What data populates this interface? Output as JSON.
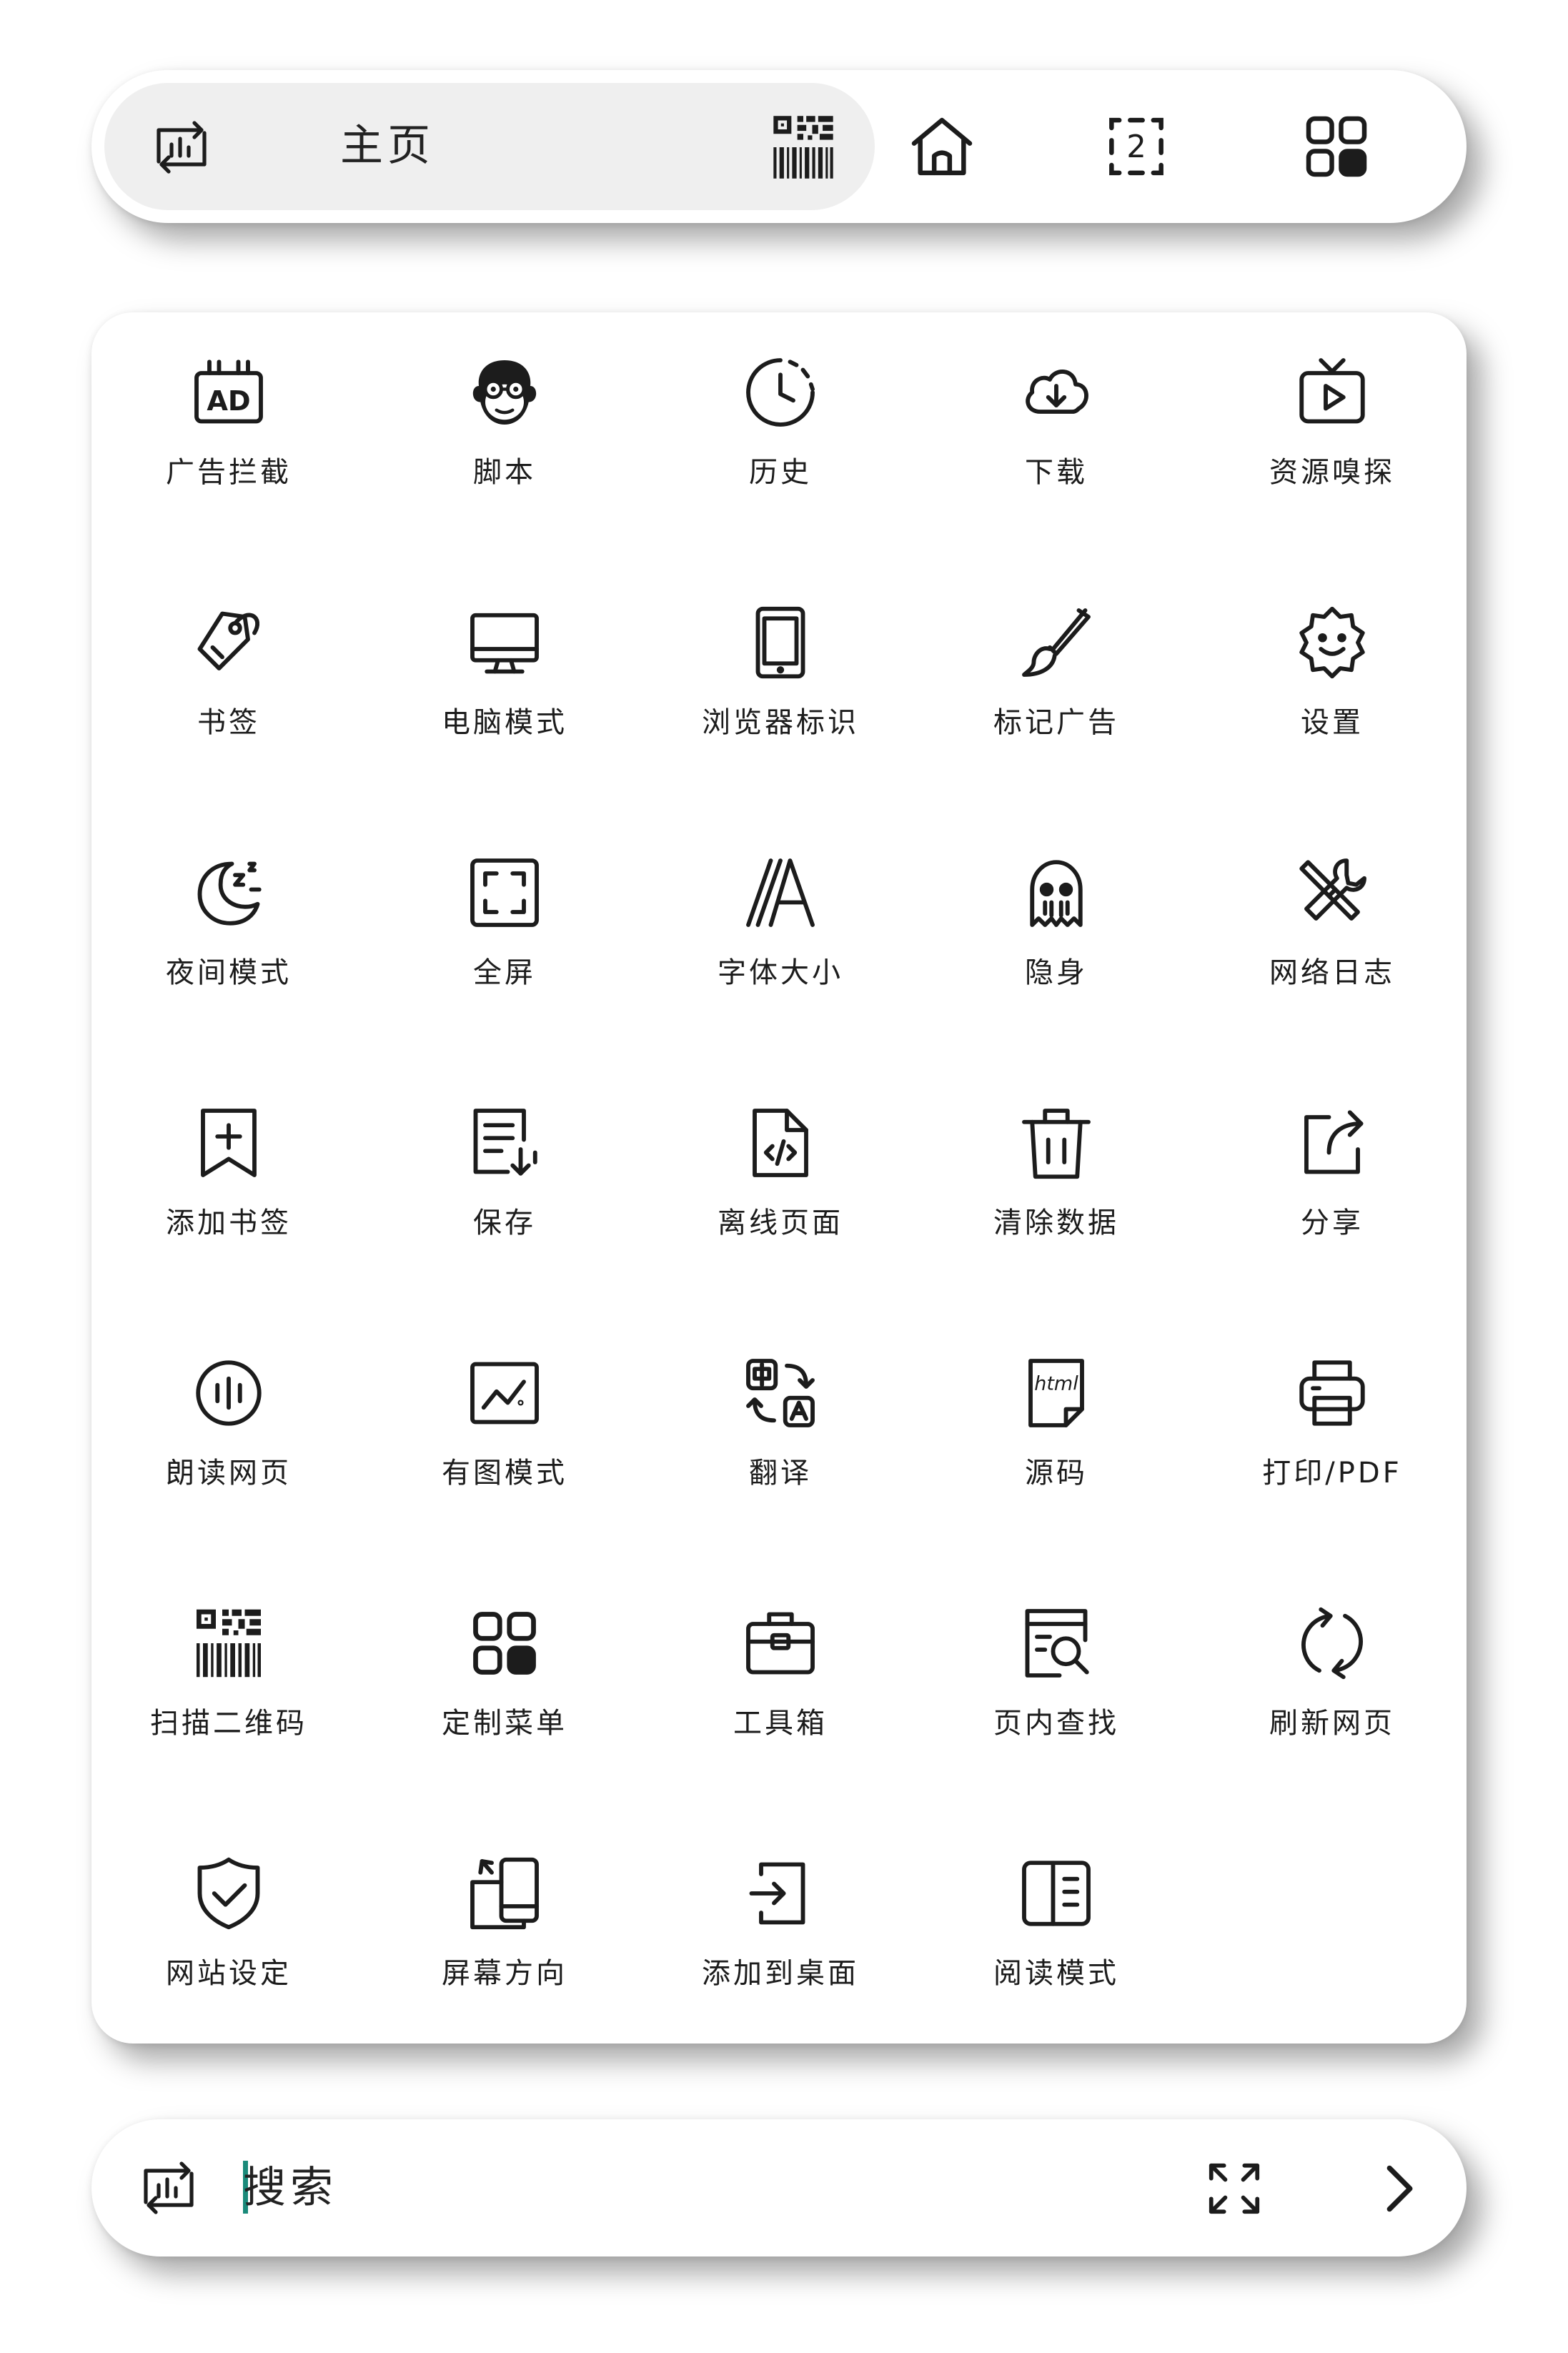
{
  "top_bar": {
    "title": "主页",
    "left_icon": "browser-switch-icon",
    "qr_icon": "qr-barcode-icon",
    "home_icon": "home-icon",
    "tabs_icon": "tabs-count-icon",
    "tabs_count": "2",
    "menu_icon": "menu-grid-icon"
  },
  "menu_items": [
    {
      "label": "广告拦截",
      "icon": "ad-block-icon"
    },
    {
      "label": "脚本",
      "icon": "monkey-script-icon"
    },
    {
      "label": "历史",
      "icon": "history-clock-icon"
    },
    {
      "label": "下载",
      "icon": "cloud-download-icon"
    },
    {
      "label": "资源嗅探",
      "icon": "media-sniff-icon"
    },
    {
      "label": "书签",
      "icon": "bookmark-tag-icon"
    },
    {
      "label": "电脑模式",
      "icon": "desktop-icon"
    },
    {
      "label": "浏览器标识",
      "icon": "phone-ua-icon"
    },
    {
      "label": "标记广告",
      "icon": "brush-icon"
    },
    {
      "label": "设置",
      "icon": "gear-icon"
    },
    {
      "label": "夜间模式",
      "icon": "moon-icon"
    },
    {
      "label": "全屏",
      "icon": "fullscreen-icon"
    },
    {
      "label": "字体大小",
      "icon": "font-size-icon"
    },
    {
      "label": "隐身",
      "icon": "ghost-icon"
    },
    {
      "label": "网络日志",
      "icon": "tools-icon"
    },
    {
      "label": "添加书签",
      "icon": "add-bookmark-icon"
    },
    {
      "label": "保存",
      "icon": "save-page-icon"
    },
    {
      "label": "离线页面",
      "icon": "offline-code-icon"
    },
    {
      "label": "清除数据",
      "icon": "trash-icon"
    },
    {
      "label": "分享",
      "icon": "share-icon"
    },
    {
      "label": "朗读网页",
      "icon": "read-aloud-icon"
    },
    {
      "label": "有图模式",
      "icon": "image-mode-icon"
    },
    {
      "label": "翻译",
      "icon": "translate-icon"
    },
    {
      "label": "源码",
      "icon": "html-source-icon"
    },
    {
      "label": "打印/PDF",
      "icon": "printer-icon"
    },
    {
      "label": "扫描二维码",
      "icon": "qr-scan-icon"
    },
    {
      "label": "定制菜单",
      "icon": "custom-menu-icon"
    },
    {
      "label": "工具箱",
      "icon": "toolbox-icon"
    },
    {
      "label": "页内查找",
      "icon": "find-in-page-icon"
    },
    {
      "label": "刷新网页",
      "icon": "refresh-icon"
    },
    {
      "label": "网站设定",
      "icon": "shield-check-icon"
    },
    {
      "label": "屏幕方向",
      "icon": "screen-rotate-icon"
    },
    {
      "label": "添加到桌面",
      "icon": "add-to-desktop-icon"
    },
    {
      "label": "阅读模式",
      "icon": "reader-mode-icon"
    }
  ],
  "bottom_bar": {
    "search_text": "搜索",
    "left_icon": "browser-switch-icon",
    "expand_icon": "expand-arrows-icon",
    "go_icon": "chevron-right-icon"
  },
  "colors": {
    "accent": "#1a8a7a",
    "pill": "#efefef",
    "ink": "#1c1c1c"
  }
}
